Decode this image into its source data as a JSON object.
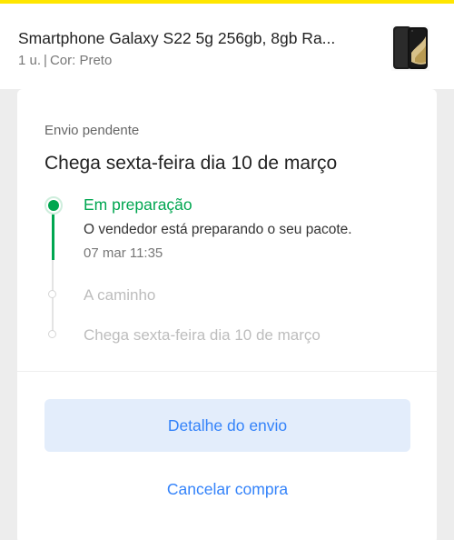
{
  "product": {
    "title": "Smartphone Galaxy S22 5g 256gb, 8gb Ra...",
    "quantity": "1 u.",
    "separator": "|",
    "color": "Cor: Preto"
  },
  "shipment": {
    "status": "Envio pendente",
    "headline": "Chega sexta-feira dia 10 de março",
    "steps": [
      {
        "title": "Em preparação",
        "description": "O vendedor está preparando o seu pacote.",
        "time": "07 mar 11:35",
        "state": "active"
      },
      {
        "title": "A caminho",
        "state": "pending"
      },
      {
        "title": "Chega sexta-feira dia 10 de março",
        "state": "pending"
      }
    ]
  },
  "actions": {
    "details_label": "Detalhe do envio",
    "cancel_label": "Cancelar compra"
  },
  "colors": {
    "brand_yellow": "#ffe600",
    "success_green": "#00a650",
    "action_blue": "#3483fa",
    "button_bg": "#e3edfb"
  }
}
